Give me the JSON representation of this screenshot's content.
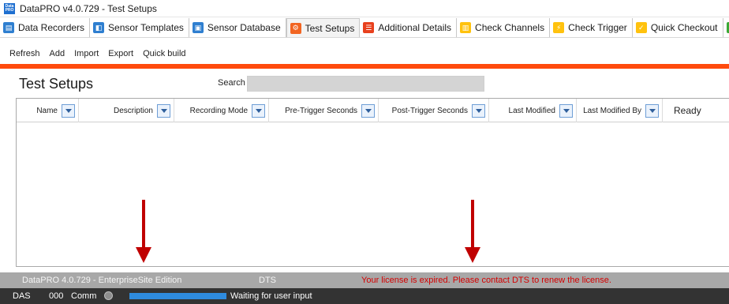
{
  "window": {
    "title": "DataPRO v4.0.729 - Test Setups",
    "icon": "datapro-app-icon",
    "icon_text": "Data PRO"
  },
  "tabs": [
    {
      "label": "Data Recorders",
      "icon": "recorder-icon",
      "color": "#2f7fd0"
    },
    {
      "label": "Sensor Templates",
      "icon": "template-icon",
      "color": "#2f7fd0"
    },
    {
      "label": "Sensor Database",
      "icon": "database-icon",
      "color": "#2f7fd0"
    },
    {
      "label": "Test Setups",
      "icon": "test-setup-icon",
      "color": "#f26522",
      "active": true
    },
    {
      "label": "Additional Details",
      "icon": "details-icon",
      "color": "#e8411e"
    },
    {
      "label": "Check Channels",
      "icon": "check-channels-icon",
      "color": "#ffc20e"
    },
    {
      "label": "Check Trigger",
      "icon": "check-trigger-icon",
      "color": "#ffc20e"
    },
    {
      "label": "Quick Checkout",
      "icon": "quick-checkout-icon",
      "color": "#ffc20e"
    },
    {
      "label": "",
      "icon": "next-tab-icon",
      "color": "#3aa935"
    }
  ],
  "toolbar": {
    "refresh": "Refresh",
    "add": "Add",
    "import": "Import",
    "export": "Export",
    "quick_build": "Quick build"
  },
  "main": {
    "title": "Test Setups",
    "search_label": "Search",
    "search_value": "",
    "search_placeholder": ""
  },
  "grid": {
    "columns": [
      {
        "label": "Name"
      },
      {
        "label": "Description"
      },
      {
        "label": "Recording Mode"
      },
      {
        "label": "Pre-Trigger Seconds"
      },
      {
        "label": "Post-Trigger Seconds"
      },
      {
        "label": "Last Modified"
      },
      {
        "label": "Last Modified By"
      }
    ],
    "ready_label": "Ready",
    "rows": []
  },
  "status": {
    "edition": "DataPRO 4.0.729 - EnterpriseSite Edition",
    "vendor": "DTS",
    "license_message": "Your license is expired. Please contact DTS to renew the license."
  },
  "bottom": {
    "das_label": "DAS",
    "das_code": "000",
    "comm_label": "Comm",
    "progress": 1.0,
    "waiting_text": "Waiting for user input"
  },
  "colors": {
    "accent": "#ff4a0d",
    "arrow": "#c00000",
    "license_text": "#d40000",
    "progress": "#2e8bde"
  }
}
